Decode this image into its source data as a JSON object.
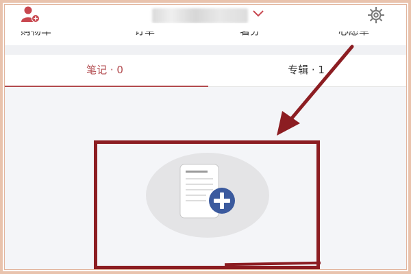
{
  "header": {
    "add_user_icon": "add-user-icon",
    "chevron_icon": "chevron-down-icon",
    "settings_icon": "gear-icon",
    "accent_color": "#c8474f"
  },
  "nav": {
    "items": [
      "购物车",
      "订单",
      "署芬",
      "心愿单"
    ]
  },
  "tabs": [
    {
      "label": "笔记 · 0",
      "active": true
    },
    {
      "label": "专辑 · 1",
      "active": false
    }
  ],
  "empty_state": {
    "icon": "add-note-icon"
  },
  "annotation": {
    "color": "#8c1d22"
  }
}
